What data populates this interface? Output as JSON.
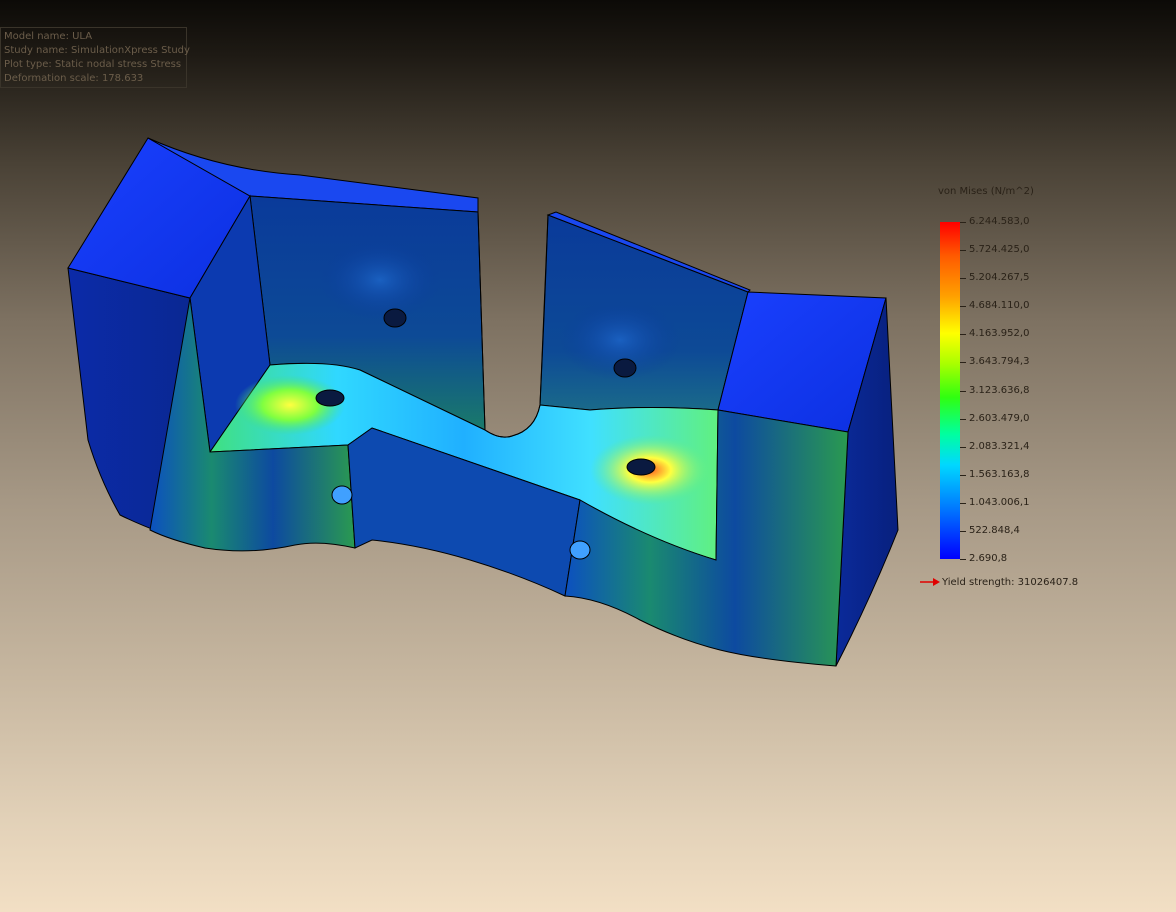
{
  "info": {
    "model_name": "Model name: ULA",
    "study_name": "Study name: SimulationXpress Study",
    "plot_type": "Plot type: Static nodal stress Stress",
    "deformation_scale": "Deformation scale: 178.633"
  },
  "legend": {
    "title": "von Mises (N/m^2)",
    "labels": [
      "6.244.583,0",
      "5.724.425,0",
      "5.204.267,5",
      "4.684.110,0",
      "4.163.952,0",
      "3.643.794,3",
      "3.123.636,8",
      "2.603.479,0",
      "2.083.321,4",
      "1.563.163,8",
      "1.043.006,1",
      "522.848,4",
      "2.690,8"
    ],
    "colors": {
      "max": "#ff0000",
      "high": "#ffa000",
      "mid_high": "#ffff00",
      "mid": "#30ff10",
      "mid_low": "#00d8ff",
      "low": "#0080ff",
      "min": "#0000ff"
    }
  },
  "yield": {
    "label": "Yield strength: 31026407.8",
    "arrow_color": "#e00000"
  },
  "model": {
    "base_color": "#0a2a9a",
    "top_face_color": "#1a3cf0"
  }
}
